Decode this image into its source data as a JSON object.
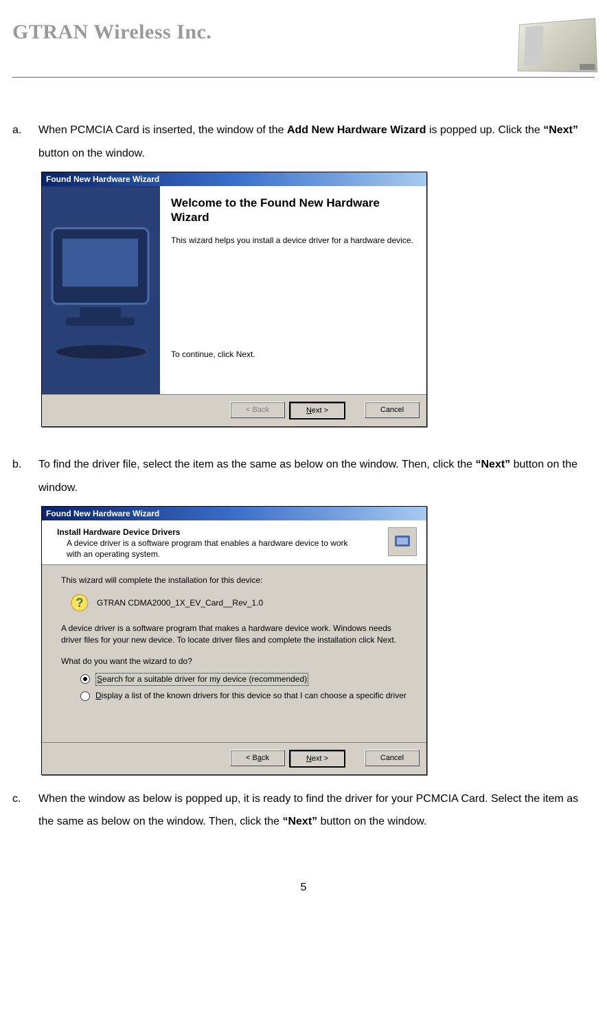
{
  "header": {
    "company": "GTRAN Wireless Inc."
  },
  "steps": {
    "a": {
      "marker": "a.",
      "text_pre": "When PCMCIA Card is inserted, the window of the ",
      "text_bold1": "Add New Hardware Wizard",
      "text_mid": " is popped up. Click the ",
      "text_bold2": "“Next”",
      "text_post": " button on the window."
    },
    "b": {
      "marker": "b.",
      "text_pre": "To find the driver file, select the item as the same as below on the window. Then, click the ",
      "text_bold1": "“Next”",
      "text_post": " button on the window."
    },
    "c": {
      "marker": "c.",
      "text_pre": "When the window as below is popped up, it is ready to find the driver for your PCMCIA Card. Select the item as the same as below on the window. Then, click the ",
      "text_bold1": "“Next”",
      "text_post": " button on the window."
    }
  },
  "dialog1": {
    "title": "Found New Hardware Wizard",
    "heading": "Welcome to the Found New Hardware Wizard",
    "line1": "This wizard helps you install a device driver for a hardware device.",
    "continue": "To continue, click Next.",
    "back": "< Back",
    "next_pre": "N",
    "next_post": "ext >",
    "cancel": "Cancel"
  },
  "dialog2": {
    "title": "Found New Hardware Wizard",
    "head_title": "Install Hardware Device Drivers",
    "head_sub": "A device driver is a software program that enables a hardware device to work with an operating system.",
    "line1": "This wizard will complete the installation for this device:",
    "device": "GTRAN CDMA2000_1X_EV_Card__Rev_1.0",
    "line2": "A device driver is a software program that makes a hardware device work. Windows needs driver files for your new device. To locate driver files and complete the installation click Next.",
    "question": "What do you want the wizard to do?",
    "opt1_pre": "S",
    "opt1_post": "earch for a suitable driver for my device (recommended)",
    "opt2_pre": "D",
    "opt2_post": "isplay a list of the known drivers for this device so that I can choose a specific driver",
    "back_pre": "< B",
    "back_post": "ack",
    "next_pre": "N",
    "next_post": "ext >",
    "cancel": "Cancel"
  },
  "page_number": "5"
}
